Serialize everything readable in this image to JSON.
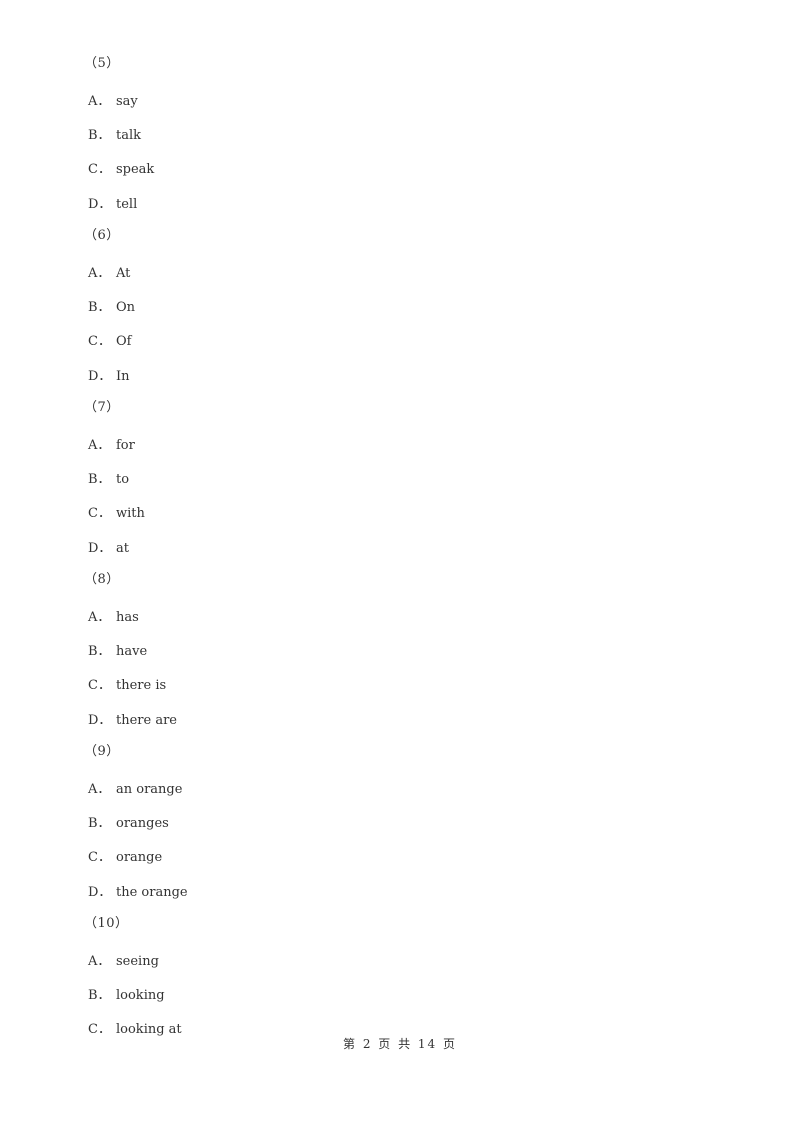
{
  "questions": [
    {
      "number": "（5）",
      "options": [
        {
          "letter": "A．",
          "text": "say"
        },
        {
          "letter": "B．",
          "text": "talk"
        },
        {
          "letter": "C．",
          "text": "speak"
        },
        {
          "letter": "D．",
          "text": "tell"
        }
      ]
    },
    {
      "number": "（6）",
      "options": [
        {
          "letter": "A．",
          "text": "At"
        },
        {
          "letter": "B．",
          "text": "On"
        },
        {
          "letter": "C．",
          "text": "Of"
        },
        {
          "letter": "D．",
          "text": "In"
        }
      ]
    },
    {
      "number": "（7）",
      "options": [
        {
          "letter": "A．",
          "text": "for"
        },
        {
          "letter": "B．",
          "text": "to"
        },
        {
          "letter": "C．",
          "text": "with"
        },
        {
          "letter": "D．",
          "text": "at"
        }
      ]
    },
    {
      "number": "（8）",
      "options": [
        {
          "letter": "A．",
          "text": "has"
        },
        {
          "letter": "B．",
          "text": "have"
        },
        {
          "letter": "C．",
          "text": "there is"
        },
        {
          "letter": "D．",
          "text": "there are"
        }
      ]
    },
    {
      "number": "（9）",
      "options": [
        {
          "letter": "A．",
          "text": "an orange"
        },
        {
          "letter": "B．",
          "text": "oranges"
        },
        {
          "letter": "C．",
          "text": "orange"
        },
        {
          "letter": "D．",
          "text": "the orange"
        }
      ]
    },
    {
      "number": "（10）",
      "options": [
        {
          "letter": "A．",
          "text": "seeing"
        },
        {
          "letter": "B．",
          "text": "looking"
        },
        {
          "letter": "C．",
          "text": "looking at"
        }
      ]
    }
  ],
  "footer": "第 2 页 共 14 页"
}
